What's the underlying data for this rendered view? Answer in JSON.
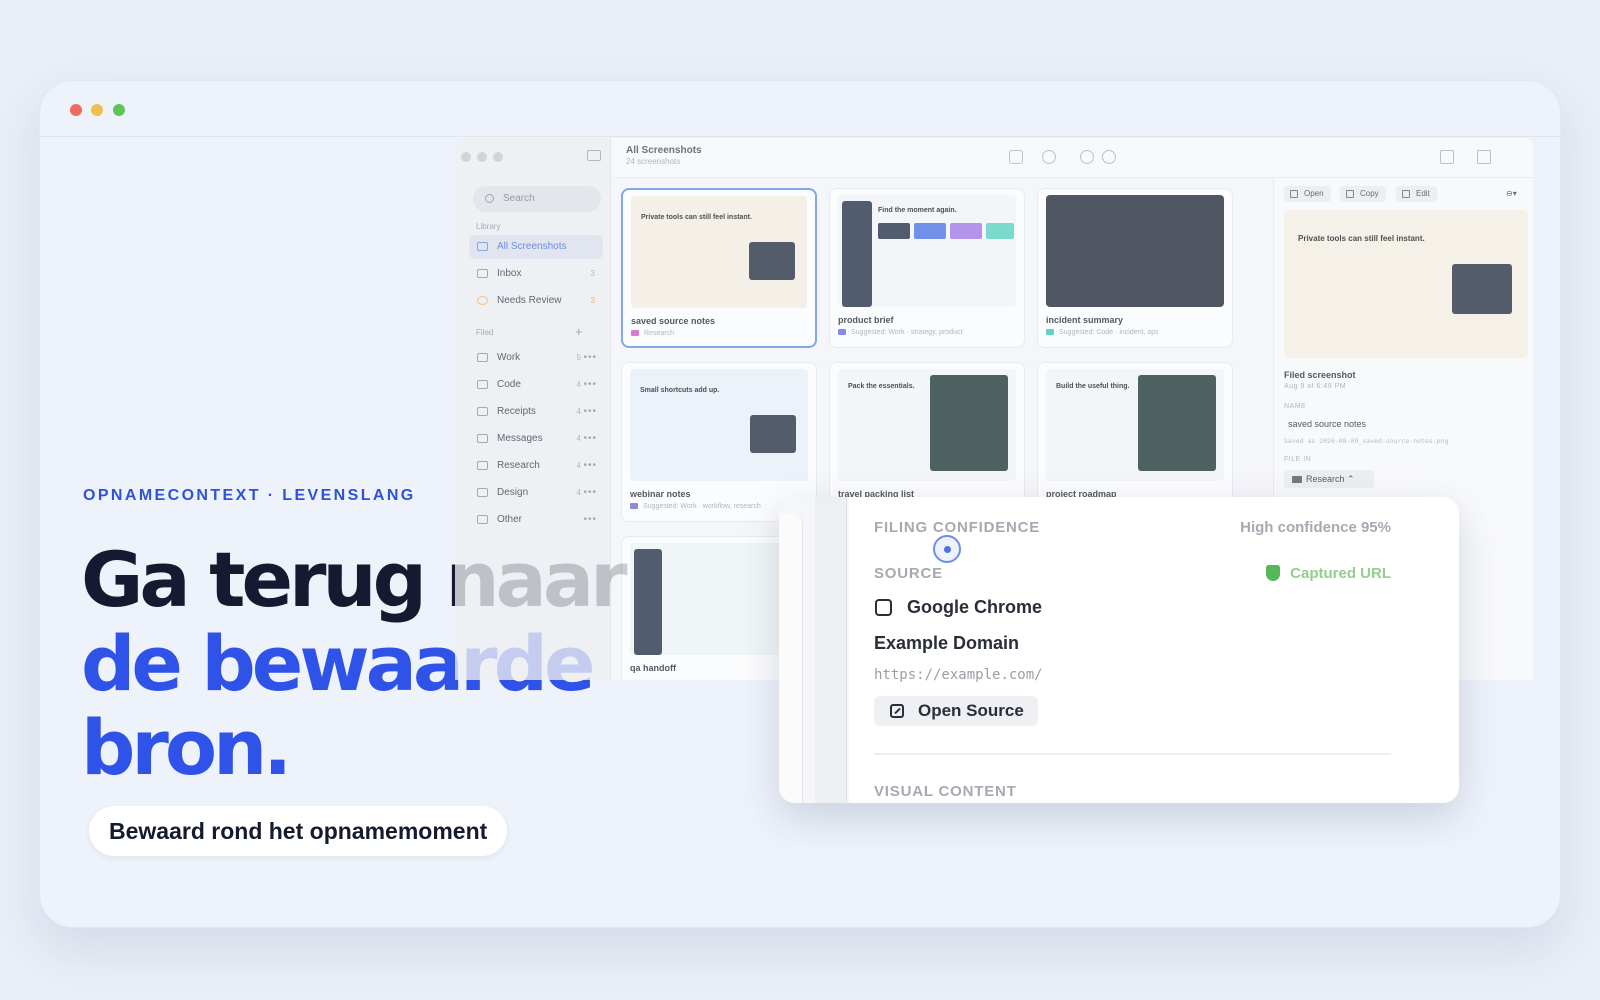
{
  "hero": {
    "eyebrow": "OPNAMECONTEXT · LEVENSLANG",
    "headline_line1": "Ga terug naar",
    "headline_line2": "de bewaarde",
    "headline_line3": "bron.",
    "pill": "Bewaard rond het opnamemoment"
  },
  "app": {
    "search_placeholder": "Search",
    "library_label": "Library",
    "library_items": [
      {
        "label": "All Screenshots",
        "count": ""
      },
      {
        "label": "Inbox",
        "count": "3"
      },
      {
        "label": "Needs Review",
        "count": "3"
      }
    ],
    "filed_label": "Filed",
    "filed_items": [
      {
        "label": "Work",
        "count": "5"
      },
      {
        "label": "Code",
        "count": "4"
      },
      {
        "label": "Receipts",
        "count": "4"
      },
      {
        "label": "Messages",
        "count": "4"
      },
      {
        "label": "Research",
        "count": "4"
      },
      {
        "label": "Design",
        "count": "4"
      },
      {
        "label": "Other",
        "count": ""
      }
    ],
    "toolbar": {
      "title": "All Screenshots",
      "subtitle": "24 screenshots"
    },
    "cards": [
      {
        "name": "saved source notes",
        "meta": "Research",
        "thumb_title": "Private tools can still feel instant."
      },
      {
        "name": "product brief",
        "meta": "Suggested: Work  ·  strategy, product",
        "thumb_title": "Find the moment again."
      },
      {
        "name": "incident summary",
        "meta": "Suggested: Code  ·  incident, ops",
        "thumb_title": ""
      },
      {
        "name": "webinar notes",
        "meta": "Suggested: Work  ·  workflow, research",
        "thumb_title": "Small shortcuts add up."
      },
      {
        "name": "travel packing list",
        "meta": "",
        "thumb_title": "Pack the essentials."
      },
      {
        "name": "project roadmap",
        "meta": "",
        "thumb_title": "Build the useful thing."
      },
      {
        "name": "qa handoff",
        "meta": "",
        "thumb_title": ""
      }
    ],
    "detail": {
      "open": "Open",
      "copy": "Copy",
      "edit": "Edit",
      "preview_title": "Private tools can still feel instant.",
      "filed_heading": "Filed screenshot",
      "filed_time": "Aug 9 at 6:49 PM",
      "name_label": "NAME",
      "name_value": "saved source notes",
      "saved_as": "Saved as 2026-08-09_saved-source-notes.png",
      "file_in_label": "FILE IN",
      "file_in_value": "Research"
    }
  },
  "callout": {
    "filing_label": "FILING CONFIDENCE",
    "confidence": "High confidence   95%",
    "source_label": "SOURCE",
    "captured": "Captured URL",
    "app_name": "Google Chrome",
    "page_title": "Example Domain",
    "url": "https://example.com/",
    "open_source": "Open Source",
    "visual_label": "VISUAL CONTENT"
  },
  "colors": {
    "accent": "#2f52e8",
    "eyebrow": "#2f52d6",
    "headline_dark": "#151a30",
    "captured_green": "#55b85a"
  }
}
